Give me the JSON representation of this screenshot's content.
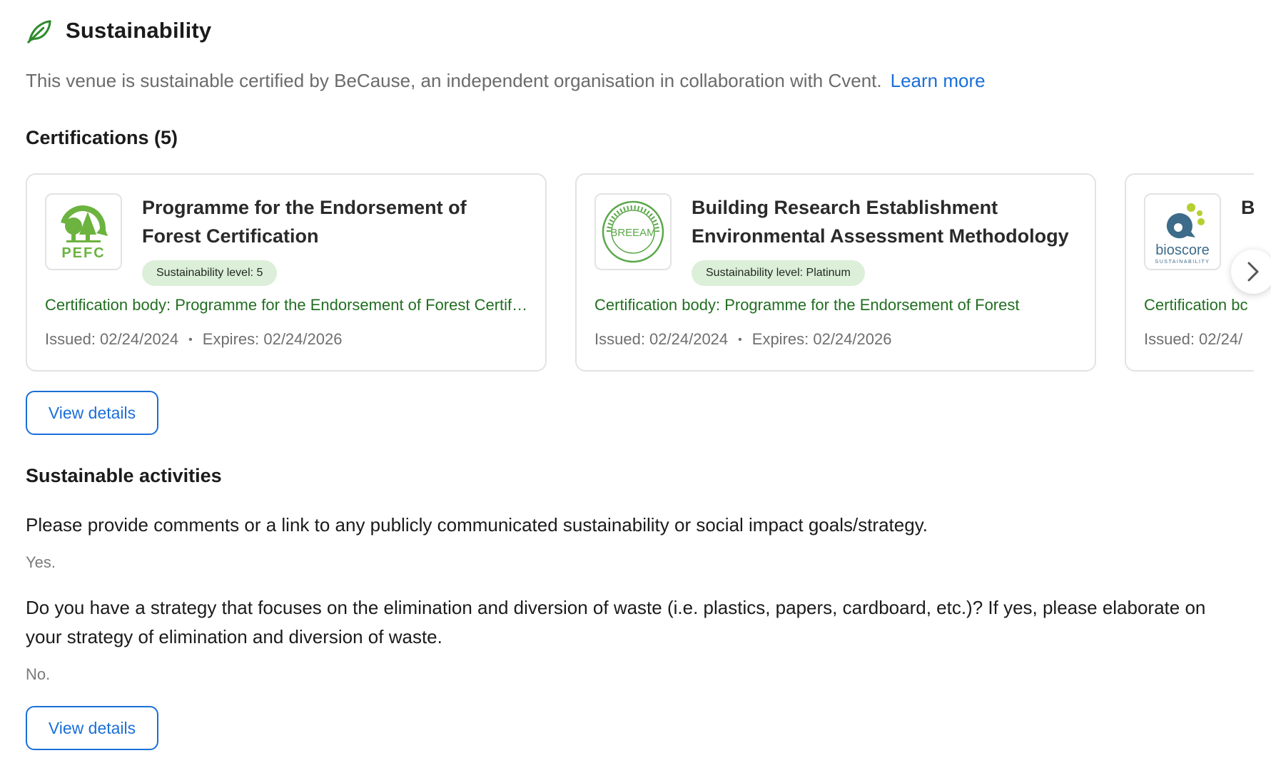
{
  "header": {
    "title": "Sustainability",
    "icon": "leaf-icon"
  },
  "intro": {
    "text": "This venue is sustainable certified by BeCause, an independent organisation in collaboration with Cvent.",
    "link": "Learn more"
  },
  "certifications": {
    "heading": "Certifications (5)",
    "cards": [
      {
        "logo": "pefc-logo",
        "logo_text": "PEFC",
        "title": "Programme for the Endorsement of Forest Certification",
        "badge": "Sustainability level: 5",
        "body": "Certification body: Programme for the Endorsement of Forest Certification",
        "issued": "Issued: 02/24/2024",
        "expires": "Expires: 02/24/2026"
      },
      {
        "logo": "breeam-logo",
        "logo_text": "BREEAM",
        "title": "Building Research Establishment Environmental Assessment Methodology",
        "badge": "Sustainability level: Platinum",
        "body": "Certification body: Programme for the Endorsement of Forest",
        "issued": "Issued: 02/24/2024",
        "expires": "Expires: 02/24/2026"
      },
      {
        "logo": "bioscore-logo",
        "logo_text": "bioscore",
        "logo_subtext": "SUSTAINABILITY",
        "title": "B",
        "body": "Certification bc",
        "issued": "Issued: 02/24/"
      }
    ],
    "view_details": "View details"
  },
  "activities": {
    "heading": "Sustainable activities",
    "items": [
      {
        "question": "Please provide comments or a link to any publicly communicated sustainability or social impact goals/strategy.",
        "answer": "Yes."
      },
      {
        "question": "Do you have a strategy that focuses on the elimination and diversion of waste (i.e. plastics, papers, cardboard, etc.)? If yes, please elaborate on your strategy of elimination and diversion of waste.",
        "answer": "No."
      }
    ],
    "view_details": "View details"
  },
  "colors": {
    "accent": "#1a6fd8",
    "green_text": "#216e21",
    "badge_bg": "#dcefd9",
    "leaf": "#2e8b2e"
  }
}
